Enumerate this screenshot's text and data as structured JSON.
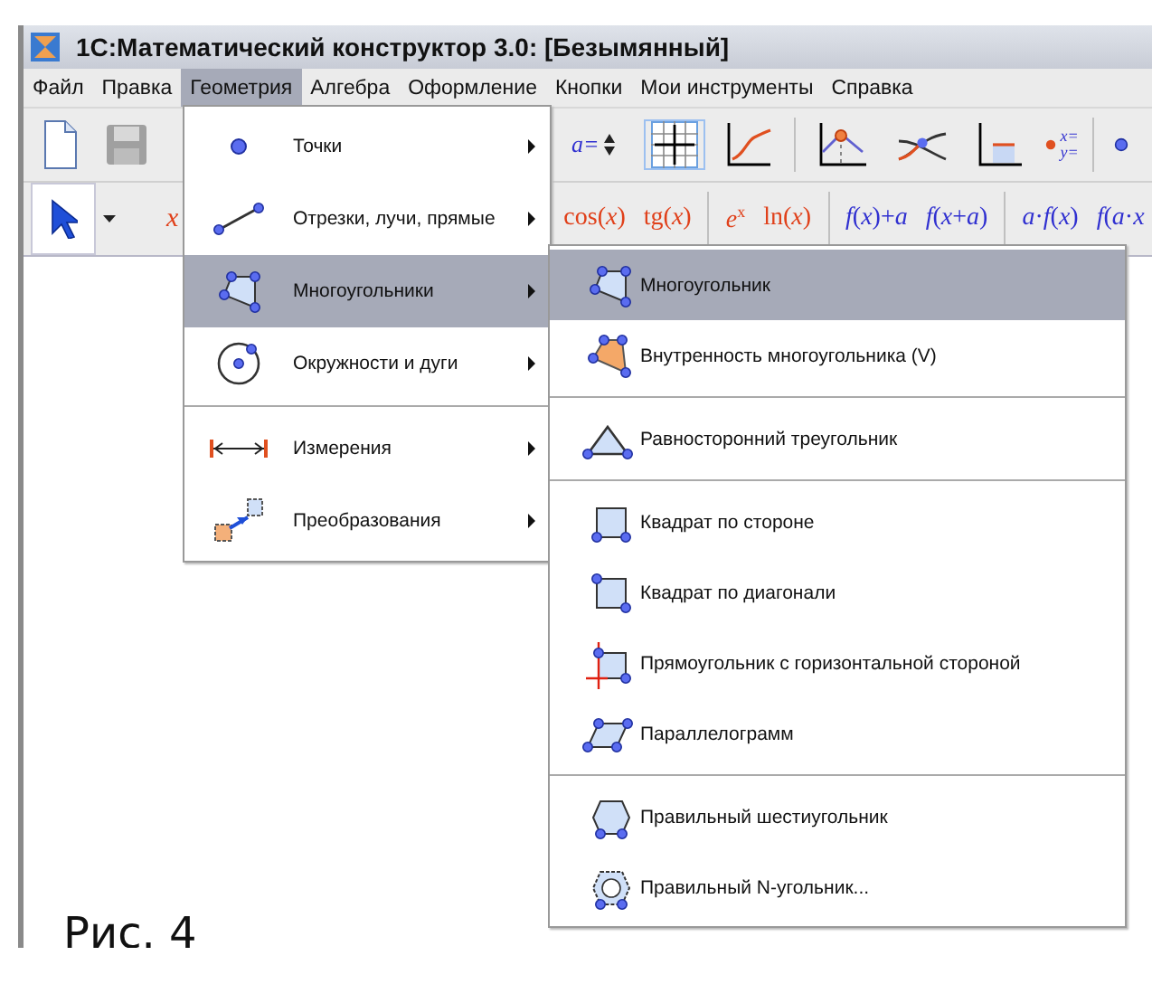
{
  "window": {
    "title": "1С:Математический конструктор 3.0: [Безымянный]"
  },
  "menubar": [
    {
      "label": "Файл",
      "selected": false
    },
    {
      "label": "Правка",
      "selected": false
    },
    {
      "label": "Геометрия",
      "selected": true
    },
    {
      "label": "Алгебра",
      "selected": false
    },
    {
      "label": "Оформление",
      "selected": false
    },
    {
      "label": "Кнопки",
      "selected": false
    },
    {
      "label": "Мои инструменты",
      "selected": false
    },
    {
      "label": "Справка",
      "selected": false
    }
  ],
  "toolbar": {
    "param_label": "a=",
    "coords_labels": [
      "x=",
      "y="
    ],
    "variable": "x",
    "formula_buttons": [
      {
        "label": "cos(*x*)",
        "color": "#e0401a"
      },
      {
        "label": "tg(*x*)",
        "color": "#e0401a"
      },
      {
        "label": "*e*$^{x}$",
        "color": "#e0401a"
      },
      {
        "label": "ln(*x*)",
        "color": "#e0401a"
      },
      {
        "label": "*f*(*x*)+*a*",
        "color": "#3030d0"
      },
      {
        "label": "*f*(*x*+*a*)",
        "color": "#3030d0"
      },
      {
        "label": "*a*·*f*(*x*)",
        "color": "#3030d0"
      },
      {
        "label": "*f*(*a*·*x*",
        "color": "#3030d0"
      }
    ]
  },
  "geometry_menu": {
    "groups": [
      [
        {
          "label": "Точки",
          "has_submenu": true,
          "selected": false
        },
        {
          "label": "Отрезки, лучи, прямые",
          "has_submenu": true,
          "selected": false
        },
        {
          "label": "Многоугольники",
          "has_submenu": true,
          "selected": true
        },
        {
          "label": "Окружности и дуги",
          "has_submenu": true,
          "selected": false
        }
      ],
      [
        {
          "label": "Измерения",
          "has_submenu": true,
          "selected": false
        },
        {
          "label": "Преобразования",
          "has_submenu": true,
          "selected": false
        }
      ]
    ]
  },
  "polygons_submenu": {
    "groups": [
      [
        {
          "label": "Многоугольник",
          "selected": true
        },
        {
          "label": "Внутренность многоугольника (V)",
          "selected": false
        }
      ],
      [
        {
          "label": "Равносторонний треугольник",
          "selected": false
        }
      ],
      [
        {
          "label": "Квадрат по стороне",
          "selected": false
        },
        {
          "label": "Квадрат по диагонали",
          "selected": false
        },
        {
          "label": "Прямоугольник с горизонтальной стороной",
          "selected": false
        },
        {
          "label": "Параллелограмм",
          "selected": false
        }
      ],
      [
        {
          "label": "Правильный шестиугольник",
          "selected": false
        },
        {
          "label": "Правильный N-угольник...",
          "selected": false
        }
      ]
    ]
  },
  "caption": "Рис. 4"
}
